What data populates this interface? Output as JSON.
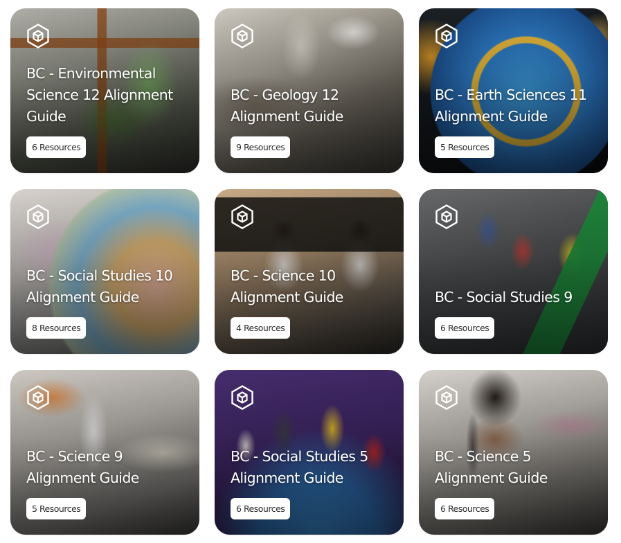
{
  "cards": [
    {
      "title": "BC - Environmental Science 12 Alignment Guide",
      "resource_count": "6",
      "resource_label": "Resources"
    },
    {
      "title": "BC - Geology 12 Alignment Guide",
      "resource_count": "9",
      "resource_label": "Resources"
    },
    {
      "title": "BC - Earth Sciences 11 Alignment Guide",
      "resource_count": "5",
      "resource_label": "Resources"
    },
    {
      "title": "BC - Social Studies 10 Alignment Guide",
      "resource_count": "8",
      "resource_label": "Resources"
    },
    {
      "title": "BC - Science 10 Alignment Guide",
      "resource_count": "4",
      "resource_label": "Resources"
    },
    {
      "title": "BC - Social Studies 9",
      "resource_count": "6",
      "resource_label": "Resources"
    },
    {
      "title": "BC - Science 9 Alignment Guide",
      "resource_count": "5",
      "resource_label": "Resources"
    },
    {
      "title": "BC - Social Studies 5 Alignment Guide",
      "resource_count": "6",
      "resource_label": "Resources"
    },
    {
      "title": "BC - Science 5 Alignment Guide",
      "resource_count": "6",
      "resource_label": "Resources"
    }
  ],
  "icons": {
    "card_logo": "hexagon-cube-logo-icon"
  },
  "colors": {
    "title_text": "#ffffff",
    "badge_bg": "#ffffff",
    "badge_text": "#2b2b2b"
  }
}
